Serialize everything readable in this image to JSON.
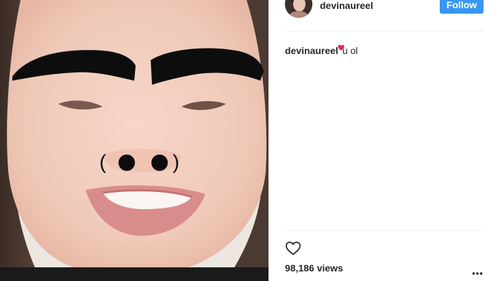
{
  "post": {
    "username": "devinaureel",
    "follow_label": "Follow",
    "caption": {
      "username": "devinaureel",
      "emoji": "heart-emoji",
      "text": "u ol"
    },
    "views_text": "98,186 views"
  },
  "icons": {
    "like": "heart-outline-icon",
    "more": "more-options-icon"
  },
  "colors": {
    "follow_button": "#3897f0",
    "text": "#262626",
    "divider": "#efefef",
    "heart_emoji": "#e0245e"
  }
}
